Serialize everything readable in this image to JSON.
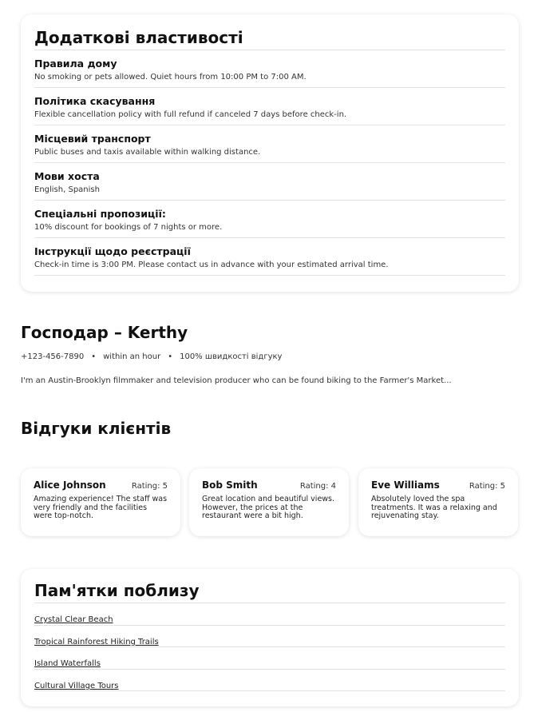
{
  "properties": {
    "title": "Додаткові властивості",
    "items": [
      {
        "label": "Правила дому",
        "value": "No smoking or pets allowed. Quiet hours from 10:00 PM to 7:00 AM."
      },
      {
        "label": "Політика скасування",
        "value": "Flexible cancellation policy with full refund if canceled 7 days before check-in."
      },
      {
        "label": "Місцевий транспорт",
        "value": "Public buses and taxis available within walking distance."
      },
      {
        "label": "Мови хоста",
        "value": "English, Spanish"
      },
      {
        "label": "Спеціальні пропозиції:",
        "value": "10% discount for bookings of 7 nights or more."
      },
      {
        "label": "Інструкції щодо реєстрації",
        "value": "Check-in time is 3:00 PM. Please contact us in advance with your estimated arrival time."
      }
    ]
  },
  "host": {
    "title": "Господар – Kerthy",
    "phone": "+123-456-7890",
    "response_time": "within an hour",
    "response_rate": "100% швидкості відгуку",
    "separator": "•",
    "bio": "I'm an Austin-Brooklyn filmmaker and television producer who can be found biking to the Farmer's Market..."
  },
  "reviews": {
    "title": "Відгуки клієнтів",
    "items": [
      {
        "name": "Alice Johnson",
        "rating": "Rating: 5",
        "text": "Amazing experience! The staff was very friendly and the facilities were top-notch."
      },
      {
        "name": "Bob Smith",
        "rating": "Rating: 4",
        "text": "Great location and beautiful views. However, the prices at the restaurant were a bit high."
      },
      {
        "name": "Eve Williams",
        "rating": "Rating: 5",
        "text": "Absolutely loved the spa treatments. It was a relaxing and rejuvenating stay."
      }
    ]
  },
  "attractions": {
    "title": "Пам'ятки поблизу",
    "items": [
      "Crystal Clear Beach",
      "Tropical Rainforest Hiking Trails",
      "Island Waterfalls",
      "Cultural Village Tours"
    ]
  }
}
